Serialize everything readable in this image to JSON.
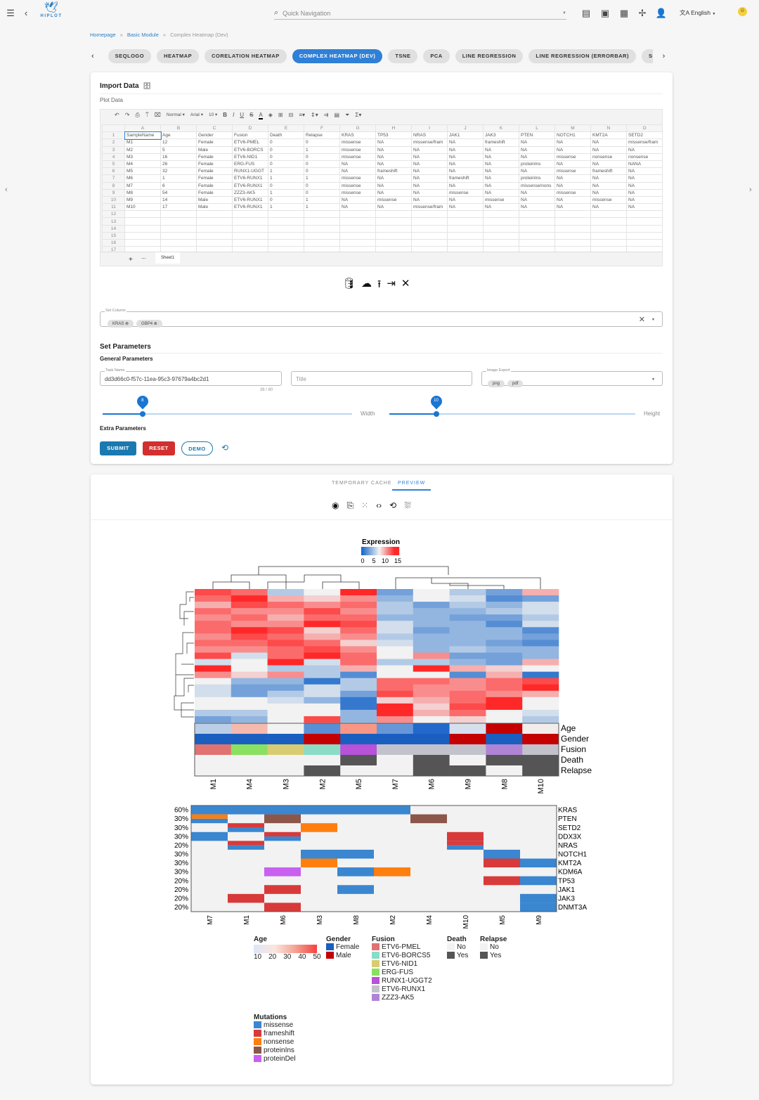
{
  "header": {
    "search_placeholder": "Quick Navigation",
    "language": "English",
    "logo_text": "HIPLOT"
  },
  "breadcrumb": [
    "Homepage",
    "Basic Module",
    "Complex Heatmap (Dev)"
  ],
  "module_tabs": [
    {
      "label": "SEQLOGO"
    },
    {
      "label": "HEATMAP"
    },
    {
      "label": "CORELATION HEATMAP"
    },
    {
      "label": "COMPLEX HEATMAP (DEV)",
      "active": true
    },
    {
      "label": "TSNE"
    },
    {
      "label": "PCA"
    },
    {
      "label": "LINE REGRESSION"
    },
    {
      "label": "LINE REGRESSION (ERRORBAR)"
    },
    {
      "label": "SC"
    }
  ],
  "import": {
    "title": "Import Data",
    "subtitle": "Plot Data",
    "toolbar": {
      "style": "Normal",
      "font": "Arial",
      "size": "10"
    },
    "col_letters": [
      "A",
      "B",
      "C",
      "D",
      "E",
      "F",
      "G",
      "H",
      "I",
      "J",
      "K",
      "L",
      "M",
      "N",
      "O"
    ],
    "rows": [
      [
        "SampleName",
        "Age",
        "Gender",
        "Fusion",
        "Death",
        "Relapse",
        "KRAS",
        "TP53",
        "NRAS",
        "JAK1",
        "JAK3",
        "PTEN",
        "NOTCH1",
        "KMT2A",
        "SETD2"
      ],
      [
        "M1",
        "12",
        "Female",
        "ETV6-PMEL",
        "0",
        "0",
        "missense",
        "NA",
        "missense/fram",
        "NA",
        "frameshift",
        "NA",
        "NA",
        "NA",
        "missense/fram"
      ],
      [
        "M2",
        "5",
        "Male",
        "ETV6-BORCS",
        "0",
        "1",
        "missense",
        "NA",
        "NA",
        "NA",
        "NA",
        "NA",
        "NA",
        "NA",
        "NA"
      ],
      [
        "M3",
        "16",
        "Female",
        "ETV6-NID1",
        "0",
        "0",
        "missense",
        "NA",
        "NA",
        "NA",
        "NA",
        "NA",
        "missense",
        "nonsense",
        "nonsense"
      ],
      [
        "M4",
        "26",
        "Female",
        "ERG-FUS",
        "0",
        "0",
        "NA",
        "NA",
        "NA",
        "NA",
        "NA",
        "proteinIns",
        "NA",
        "NA",
        "NANA"
      ],
      [
        "M5",
        "32",
        "Female",
        "RUNX1-UGGT",
        "1",
        "0",
        "NA",
        "frameshift",
        "NA",
        "NA",
        "NA",
        "NA",
        "missense",
        "frameshift",
        "NA"
      ],
      [
        "M6",
        "1",
        "Female",
        "ETV6-RUNX1",
        "1",
        "1",
        "missense",
        "NA",
        "NA",
        "frameshift",
        "NA",
        "proteinIns",
        "NA",
        "NA",
        "NA"
      ],
      [
        "M7",
        "6",
        "Female",
        "ETV6-RUNX1",
        "0",
        "0",
        "missense",
        "NA",
        "NA",
        "NA",
        "NA",
        "missense/nons",
        "NA",
        "NA",
        "NA"
      ],
      [
        "M8",
        "54",
        "Female",
        "ZZZ3-AK5",
        "1",
        "0",
        "missense",
        "NA",
        "NA",
        "missense",
        "NA",
        "NA",
        "missense",
        "NA",
        "NA"
      ],
      [
        "M9",
        "14",
        "Male",
        "ETV6-RUNX1",
        "0",
        "1",
        "NA",
        "missense",
        "NA",
        "NA",
        "missense",
        "NA",
        "NA",
        "missense",
        "NA"
      ],
      [
        "M10",
        "17",
        "Male",
        "ETV6-RUNX1",
        "1",
        "1",
        "NA",
        "NA",
        "missense/fram",
        "NA",
        "NA",
        "NA",
        "NA",
        "NA",
        "NA"
      ]
    ],
    "total_rows": 17,
    "sheet_tab": "Sheet1",
    "set_column_label": "Set Column",
    "set_column_chips": [
      "KRAS",
      "GBP4"
    ]
  },
  "params": {
    "title": "Set Parameters",
    "general": "General Parameters",
    "task_name_label": "Task Name",
    "task_name": "dd3d66c0-f57c-11ea-95c3-97679a4bc2d1",
    "task_counter": "36 / 80",
    "title_placeholder": "Title",
    "export_label": "Image Export",
    "export_chips": [
      "png",
      "pdf"
    ],
    "width_label": "Width",
    "width_value": "8",
    "width_fraction": 0.16,
    "height_label": "Height",
    "height_value": "10",
    "height_fraction": 0.19,
    "extra": "Extra Parameters",
    "submit": "SUBMIT",
    "reset": "RESET",
    "demo": "DEMO"
  },
  "preview": {
    "tabs": [
      "TEMPORARY CACHE",
      "PREVIEW"
    ],
    "active_tab": 1
  },
  "chart_data": [
    {
      "type": "heatmap",
      "legend_title": "Expression",
      "legend_ticks": [
        "0",
        "5",
        "10",
        "15"
      ],
      "range": [
        0,
        15
      ],
      "columns": [
        "M1",
        "M4",
        "M3",
        "M2",
        "M5",
        "M7",
        "M6",
        "M9",
        "M8",
        "M10"
      ],
      "values": [
        [
          12,
          11,
          5,
          7,
          14,
          3,
          7,
          5,
          3,
          9
        ],
        [
          11,
          13,
          9,
          8,
          10,
          4,
          7,
          6,
          2,
          3
        ],
        [
          9,
          12,
          11,
          10,
          11,
          5,
          3,
          5,
          4,
          6
        ],
        [
          11,
          10,
          10,
          12,
          10,
          5,
          4,
          4,
          5,
          6
        ],
        [
          10,
          11,
          9,
          11,
          11,
          4,
          4,
          3,
          3,
          5
        ],
        [
          11,
          10,
          10,
          13,
          12,
          6,
          4,
          4,
          2,
          6
        ],
        [
          11,
          13,
          12,
          8,
          11,
          6,
          3,
          4,
          4,
          2
        ],
        [
          10,
          12,
          11,
          9,
          10,
          5,
          4,
          4,
          4,
          3
        ],
        [
          11,
          11,
          12,
          11,
          8,
          6,
          4,
          4,
          3,
          2
        ],
        [
          10,
          10,
          11,
          12,
          10,
          7,
          4,
          5,
          4,
          4
        ],
        [
          12,
          6,
          11,
          13,
          11,
          7,
          10,
          3,
          3,
          4
        ],
        [
          6,
          7,
          14,
          6,
          11,
          5,
          5,
          4,
          3,
          9
        ],
        [
          14,
          7,
          5,
          5,
          9,
          7,
          14,
          9,
          8,
          7
        ],
        [
          10,
          8,
          10,
          5,
          2,
          7,
          7,
          2,
          9,
          1
        ],
        [
          7,
          4,
          4,
          1,
          5,
          11,
          11,
          10,
          11,
          12
        ],
        [
          6,
          3,
          3,
          6,
          5,
          11,
          10,
          10,
          11,
          14
        ],
        [
          6,
          3,
          5,
          6,
          3,
          12,
          10,
          11,
          10,
          9
        ],
        [
          7,
          7,
          6,
          4,
          1,
          8,
          9,
          11,
          14,
          7
        ],
        [
          7,
          7,
          7,
          7,
          1,
          14,
          8,
          12,
          14,
          7
        ],
        [
          5,
          5,
          7,
          7,
          4,
          14,
          9,
          11,
          7,
          6
        ],
        [
          3,
          4,
          7,
          12,
          4,
          10,
          7,
          8,
          7,
          5
        ]
      ],
      "annotations": [
        {
          "name": "Age",
          "values": [
            12,
            26,
            16,
            5,
            32,
            6,
            1,
            14,
            54,
            17
          ]
        },
        {
          "name": "Gender",
          "values": [
            "Female",
            "Female",
            "Female",
            "Male",
            "Female",
            "Female",
            "Female",
            "Male",
            "Female",
            "Male"
          ]
        },
        {
          "name": "Fusion",
          "values": [
            "ETV6-PMEL",
            "ERG-FUS",
            "ETV6-NID1",
            "ETV6-BORCS5",
            "RUNX1-UGGT2",
            "ETV6-RUNX1",
            "ETV6-RUNX1",
            "ETV6-RUNX1",
            "ZZZ3-AK5",
            "ETV6-RUNX1"
          ]
        },
        {
          "name": "Death",
          "values": [
            "No",
            "No",
            "No",
            "No",
            "Yes",
            "No",
            "Yes",
            "No",
            "Yes",
            "Yes"
          ]
        },
        {
          "name": "Relapse",
          "values": [
            "No",
            "No",
            "No",
            "Yes",
            "No",
            "No",
            "Yes",
            "Yes",
            "No",
            "Yes"
          ]
        }
      ]
    },
    {
      "type": "oncoprint",
      "columns": [
        "M7",
        "M1",
        "M6",
        "M3",
        "M8",
        "M2",
        "M4",
        "M10",
        "M5",
        "M9"
      ],
      "genes": [
        {
          "gene": "KRAS",
          "pct": "60%",
          "hits": {
            "M7": [
              "missense"
            ],
            "M1": [
              "missense"
            ],
            "M6": [
              "missense"
            ],
            "M3": [
              "missense"
            ],
            "M8": [
              "missense"
            ],
            "M2": [
              "missense"
            ]
          }
        },
        {
          "gene": "PTEN",
          "pct": "30%",
          "hits": {
            "M7": [
              "nonsense",
              "missense"
            ],
            "M6": [
              "proteinIns"
            ],
            "M4": [
              "proteinIns"
            ]
          }
        },
        {
          "gene": "SETD2",
          "pct": "30%",
          "hits": {
            "M1": [
              "frameshift",
              "missense"
            ],
            "M3": [
              "nonsense"
            ]
          }
        },
        {
          "gene": "DDX3X",
          "pct": "30%",
          "hits": {
            "M7": [
              "missense"
            ],
            "M6": [
              "frameshift",
              "missense"
            ],
            "M10": [
              "frameshift"
            ]
          }
        },
        {
          "gene": "NRAS",
          "pct": "20%",
          "hits": {
            "M1": [
              "frameshift",
              "missense"
            ],
            "M10": [
              "frameshift",
              "missense"
            ]
          }
        },
        {
          "gene": "NOTCH1",
          "pct": "30%",
          "hits": {
            "M3": [
              "missense"
            ],
            "M8": [
              "missense"
            ],
            "M5": [
              "missense"
            ]
          }
        },
        {
          "gene": "KMT2A",
          "pct": "30%",
          "hits": {
            "M3": [
              "nonsense"
            ],
            "M5": [
              "frameshift"
            ],
            "M9": [
              "missense"
            ]
          }
        },
        {
          "gene": "KDM6A",
          "pct": "30%",
          "hits": {
            "M6": [
              "proteinDel"
            ],
            "M8": [
              "missense"
            ],
            "M2": [
              "nonsense"
            ]
          }
        },
        {
          "gene": "TP53",
          "pct": "20%",
          "hits": {
            "M5": [
              "frameshift"
            ],
            "M9": [
              "missense"
            ]
          }
        },
        {
          "gene": "JAK1",
          "pct": "20%",
          "hits": {
            "M6": [
              "frameshift"
            ],
            "M8": [
              "missense"
            ]
          }
        },
        {
          "gene": "JAK3",
          "pct": "20%",
          "hits": {
            "M1": [
              "frameshift"
            ],
            "M9": [
              "missense"
            ]
          }
        },
        {
          "gene": "DNMT3A",
          "pct": "20%",
          "hits": {
            "M6": [
              "frameshift"
            ],
            "M9": [
              "missense"
            ]
          }
        }
      ]
    }
  ],
  "legends": {
    "age": {
      "title": "Age",
      "ticks": [
        "10",
        "20",
        "30",
        "40",
        "50"
      ]
    },
    "gender": {
      "title": "Gender",
      "items": [
        {
          "label": "Female",
          "color": "#1a5fc0"
        },
        {
          "label": "Male",
          "color": "#c40000"
        }
      ]
    },
    "fusion": {
      "title": "Fusion",
      "items": [
        {
          "label": "ETV6-PMEL",
          "color": "#e07272"
        },
        {
          "label": "ETV6-BORCS5",
          "color": "#8adcc6"
        },
        {
          "label": "ETV6-NID1",
          "color": "#d8cc72"
        },
        {
          "label": "ERG-FUS",
          "color": "#8ae060"
        },
        {
          "label": "RUNX1-UGGT2",
          "color": "#b852d8"
        },
        {
          "label": "ETV6-RUNX1",
          "color": "#c2c2cc"
        },
        {
          "label": "ZZZ3-AK5",
          "color": "#b084d4"
        }
      ]
    },
    "death": {
      "title": "Death",
      "items": [
        {
          "label": "No",
          "color": "#f2f2f2"
        },
        {
          "label": "Yes",
          "color": "#555555"
        }
      ]
    },
    "relapse": {
      "title": "Relapse",
      "items": [
        {
          "label": "No",
          "color": "#f2f2f2"
        },
        {
          "label": "Yes",
          "color": "#555555"
        }
      ]
    },
    "mutations": {
      "title": "Mutations",
      "items": [
        {
          "label": "missense",
          "color": "#3a86d0"
        },
        {
          "label": "frameshift",
          "color": "#d83a3a"
        },
        {
          "label": "nonsense",
          "color": "#ff7f0e"
        },
        {
          "label": "proteinIns",
          "color": "#8c564b"
        },
        {
          "label": "proteinDel",
          "color": "#c860f0"
        }
      ]
    }
  }
}
